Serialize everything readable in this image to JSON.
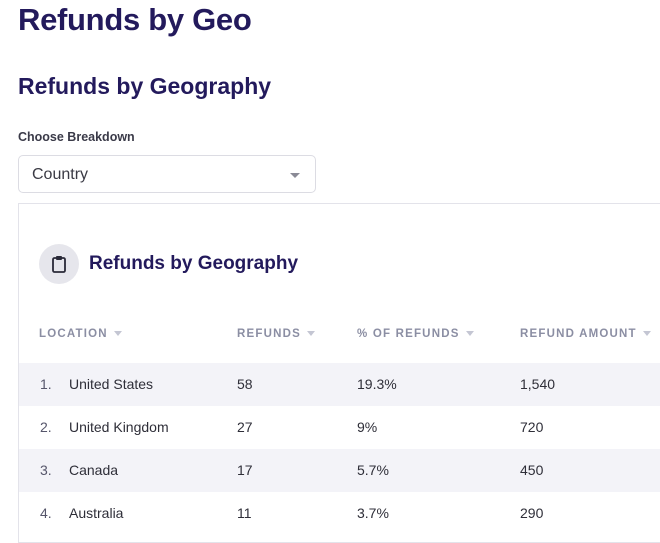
{
  "page": {
    "title": "Refunds by Geo",
    "section_title": "Refunds by Geography"
  },
  "breakdown": {
    "label": "Choose Breakdown",
    "selected": "Country"
  },
  "card": {
    "icon": "clipboard-icon",
    "title": "Refunds by Geography"
  },
  "table": {
    "columns": [
      "LOCATION",
      "REFUNDS",
      "% OF REFUNDS",
      "REFUND AMOUNT"
    ],
    "rows": [
      {
        "index": "1.",
        "location": "United States",
        "refunds": "58",
        "pct": "19.3%",
        "amount": "1,540"
      },
      {
        "index": "2.",
        "location": "United Kingdom",
        "refunds": "27",
        "pct": "9%",
        "amount": "720"
      },
      {
        "index": "3.",
        "location": "Canada",
        "refunds": "17",
        "pct": "5.7%",
        "amount": "450"
      },
      {
        "index": "4.",
        "location": "Australia",
        "refunds": "11",
        "pct": "3.7%",
        "amount": "290"
      }
    ]
  },
  "colors": {
    "title": "#231a5c",
    "header_text": "#8b8ea3",
    "row_shade": "#f3f3f8"
  }
}
